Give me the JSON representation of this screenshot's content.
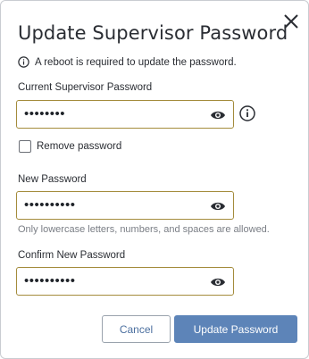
{
  "dialog": {
    "title": "Update Supervisor Password",
    "notice": "A reboot is required to update the password."
  },
  "current_password": {
    "label": "Current Supervisor Password",
    "masked_value": "••••••••"
  },
  "remove_password": {
    "label": "Remove password",
    "checked": false
  },
  "new_password": {
    "label": "New Password",
    "masked_value": "••••••••••",
    "hint": "Only lowercase letters, numbers, and spaces are allowed."
  },
  "confirm_password": {
    "label": "Confirm New Password",
    "masked_value": "••••••••••"
  },
  "buttons": {
    "cancel": "Cancel",
    "update": "Update Password"
  },
  "colors": {
    "field_border": "#a48c3c",
    "primary_button": "#5d84b8",
    "cancel_text": "#4b6f9f"
  },
  "icons": [
    "close-icon",
    "info-icon",
    "eye-icon"
  ]
}
